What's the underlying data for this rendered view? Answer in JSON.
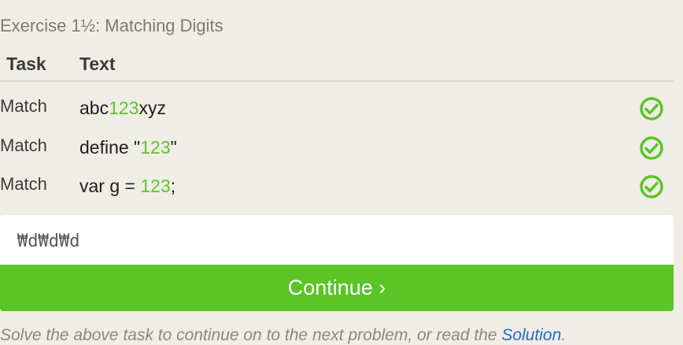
{
  "title": "Exercise 1½: Matching Digits",
  "table": {
    "header_task": "Task",
    "header_text": "Text",
    "rows": [
      {
        "task": "Match",
        "pre": "abc",
        "hl": "123",
        "post": "xyz",
        "status": "check-icon"
      },
      {
        "task": "Match",
        "pre": "define \"",
        "hl": "123",
        "post": "\"",
        "status": "check-icon"
      },
      {
        "task": "Match",
        "pre": "var g = ",
        "hl": "123",
        "post": ";",
        "status": "check-icon"
      }
    ]
  },
  "input": {
    "value": "₩d₩d₩d"
  },
  "continue_label": "Continue ›",
  "footer": {
    "text": "Solve the above task to continue on to the next problem, or read the ",
    "link": "Solution",
    "end": "."
  },
  "colors": {
    "accent": "#5bc526",
    "link": "#1e6ec8",
    "background": "#efede6"
  }
}
